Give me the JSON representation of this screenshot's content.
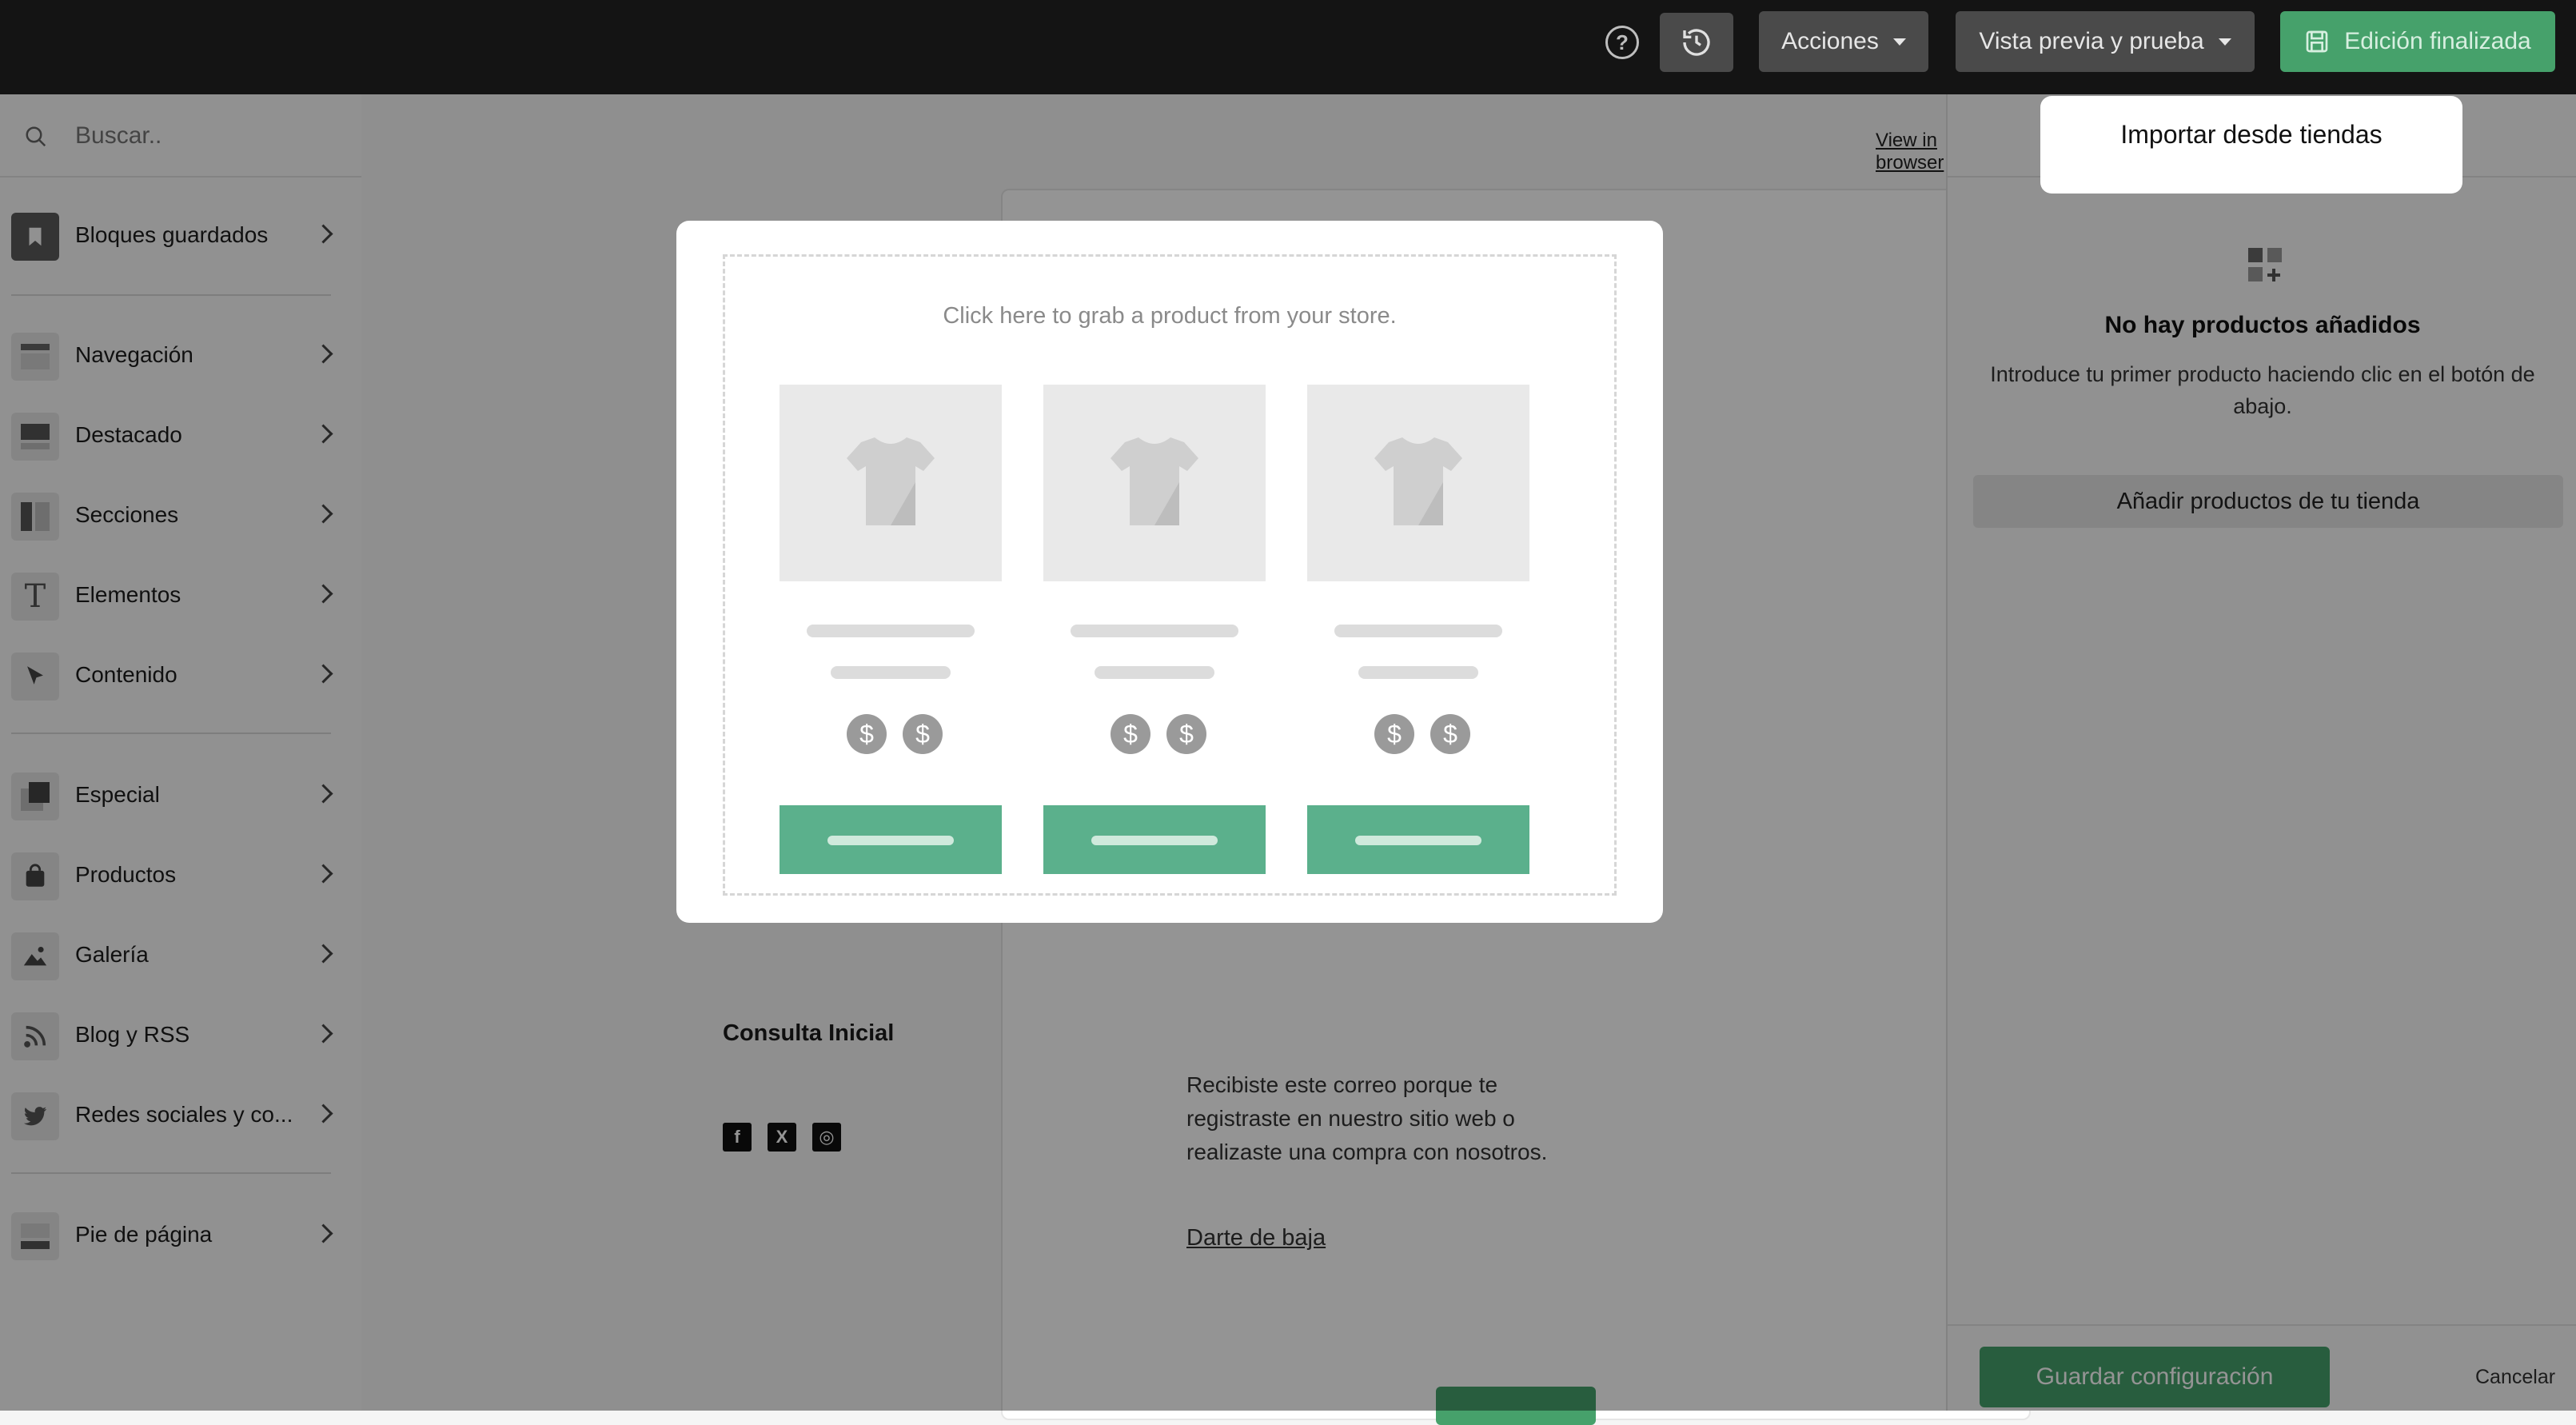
{
  "topbar": {
    "help_glyph": "?",
    "actions_label": "Acciones",
    "preview_label": "Vista previa y prueba",
    "done_label": "Edición finalizada"
  },
  "sidebar": {
    "search_placeholder": "Buscar..",
    "items": [
      {
        "label": "Bloques guardados",
        "icon": "bookmark-icon"
      },
      {
        "label": "Navegación",
        "icon": "navigation-icon"
      },
      {
        "label": "Destacado",
        "icon": "featured-icon"
      },
      {
        "label": "Secciones",
        "icon": "sections-icon"
      },
      {
        "label": "Elementos",
        "icon": "text-icon"
      },
      {
        "label": "Contenido",
        "icon": "cursor-icon"
      },
      {
        "label": "Especial",
        "icon": "special-icon"
      },
      {
        "label": "Productos",
        "icon": "bag-icon"
      },
      {
        "label": "Galería",
        "icon": "image-icon"
      },
      {
        "label": "Blog y RSS",
        "icon": "rss-icon"
      },
      {
        "label": "Redes sociales y co...",
        "icon": "twitter-icon"
      },
      {
        "label": "Pie de página",
        "icon": "footer-icon"
      }
    ]
  },
  "main": {
    "view_in_browser": "View in browser",
    "footer_title": "Consulta Inicial",
    "social": [
      "f",
      "X",
      "◎"
    ],
    "footer_text": "Recibiste este correo porque te registraste en nuestro sitio web o realizaste una compra con nosotros.",
    "unsubscribe": "Darte de baja"
  },
  "modal": {
    "grab_text": "Click here to grab a product from your store.",
    "currency_glyph": "$"
  },
  "right_panel": {
    "import_label": "Importar desde tiendas",
    "empty_title": "No hay productos añadidos",
    "empty_desc": "Introduce tu primer producto haciendo clic en el botón de abajo.",
    "add_button": "Añadir productos de tu tienda",
    "save_button": "Guardar configuración",
    "cancel": "Cancelar"
  },
  "colors": {
    "accent_green": "#46a16b",
    "product_button": "#5bb08c",
    "topbar": "#141414"
  }
}
